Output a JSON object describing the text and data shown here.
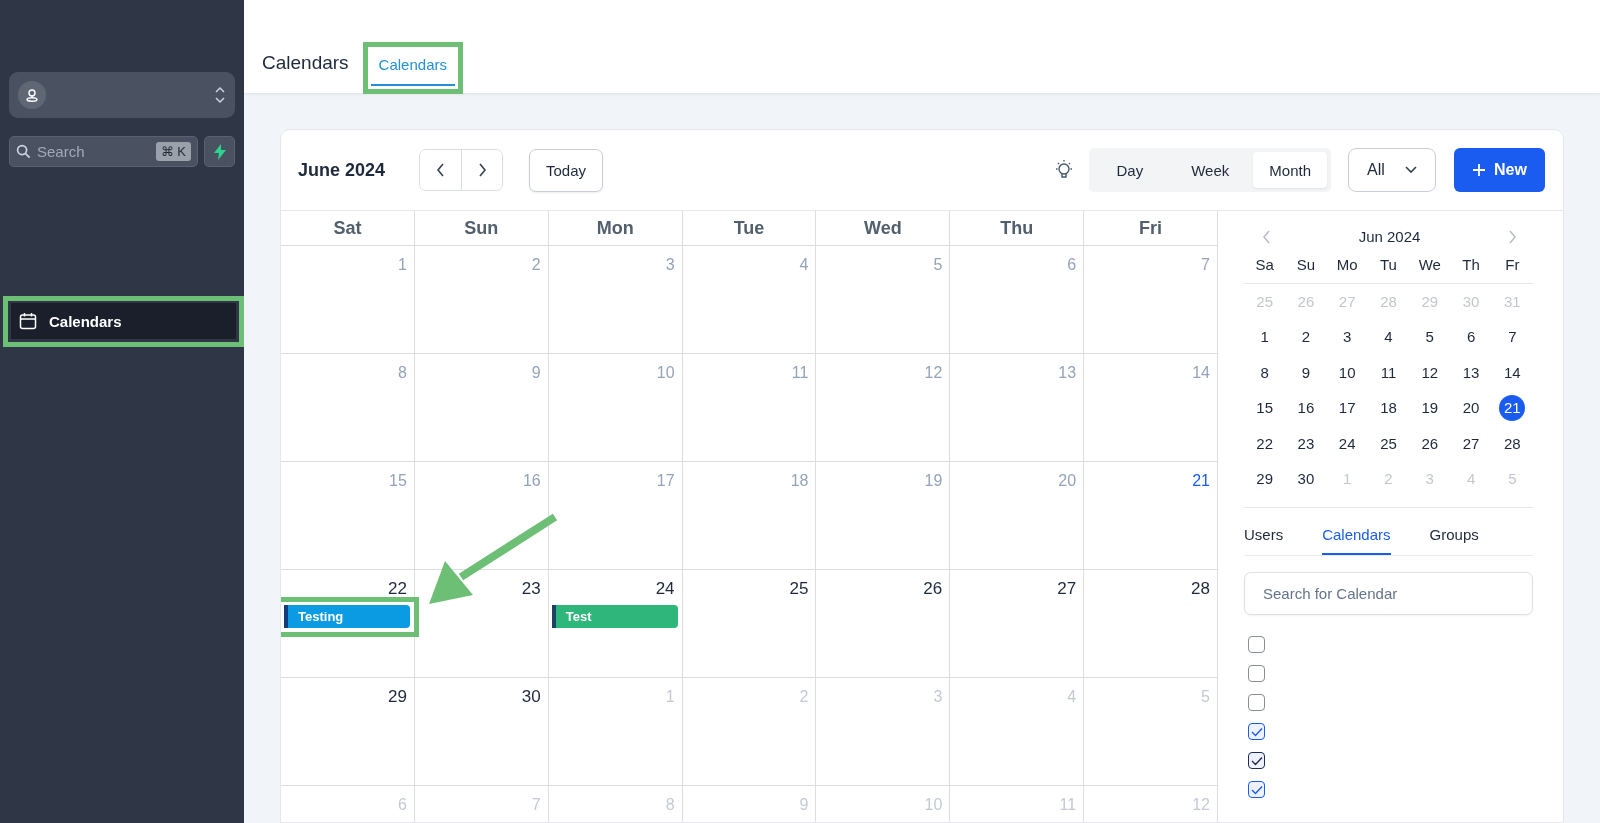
{
  "sidebar": {
    "search": {
      "placeholder": "Search",
      "shortcut": "⌘ K"
    },
    "items": [
      {
        "label": "Calendars",
        "selected": true,
        "highlighted": true
      }
    ]
  },
  "header": {
    "title": "Calendars",
    "tabs": [
      {
        "label": "Calendars",
        "selected": true,
        "highlighted": true
      }
    ]
  },
  "toolbar": {
    "month": "June 2024",
    "today": "Today",
    "views": [
      {
        "label": "Day",
        "selected": false
      },
      {
        "label": "Week",
        "selected": false
      },
      {
        "label": "Month",
        "selected": true
      }
    ],
    "filter": "All",
    "new_button": "New"
  },
  "weekdays": [
    "Sat",
    "Sun",
    "Mon",
    "Tue",
    "Wed",
    "Thu",
    "Fri"
  ],
  "weeks": [
    [
      {
        "day": "1",
        "kind": "past"
      },
      {
        "day": "2",
        "kind": "past"
      },
      {
        "day": "3",
        "kind": "past"
      },
      {
        "day": "4",
        "kind": "past"
      },
      {
        "day": "5",
        "kind": "past"
      },
      {
        "day": "6",
        "kind": "past"
      },
      {
        "day": "7",
        "kind": "past"
      }
    ],
    [
      {
        "day": "8",
        "kind": "past"
      },
      {
        "day": "9",
        "kind": "past"
      },
      {
        "day": "10",
        "kind": "past"
      },
      {
        "day": "11",
        "kind": "past"
      },
      {
        "day": "12",
        "kind": "past"
      },
      {
        "day": "13",
        "kind": "past"
      },
      {
        "day": "14",
        "kind": "past"
      }
    ],
    [
      {
        "day": "15",
        "kind": "past"
      },
      {
        "day": "16",
        "kind": "past"
      },
      {
        "day": "17",
        "kind": "past"
      },
      {
        "day": "18",
        "kind": "past"
      },
      {
        "day": "19",
        "kind": "past"
      },
      {
        "day": "20",
        "kind": "past"
      },
      {
        "day": "21",
        "kind": "today"
      }
    ],
    [
      {
        "day": "22",
        "kind": "future",
        "events": [
          {
            "title": "Testing",
            "color": "#0b9be3",
            "highlighted": true
          }
        ]
      },
      {
        "day": "23",
        "kind": "future"
      },
      {
        "day": "24",
        "kind": "future",
        "events": [
          {
            "title": "Test",
            "color": "#2fb67a",
            "highlighted": false
          }
        ]
      },
      {
        "day": "25",
        "kind": "future"
      },
      {
        "day": "26",
        "kind": "future"
      },
      {
        "day": "27",
        "kind": "future"
      },
      {
        "day": "28",
        "kind": "future"
      }
    ],
    [
      {
        "day": "29",
        "kind": "future"
      },
      {
        "day": "30",
        "kind": "future"
      },
      {
        "day": "1",
        "kind": "other_month"
      },
      {
        "day": "2",
        "kind": "other_month"
      },
      {
        "day": "3",
        "kind": "other_month"
      },
      {
        "day": "4",
        "kind": "other_month"
      },
      {
        "day": "5",
        "kind": "other_month"
      }
    ],
    [
      {
        "day": "6",
        "kind": "other_month"
      },
      {
        "day": "7",
        "kind": "other_month"
      },
      {
        "day": "8",
        "kind": "other_month"
      },
      {
        "day": "9",
        "kind": "other_month"
      },
      {
        "day": "10",
        "kind": "other_month"
      },
      {
        "day": "11",
        "kind": "other_month"
      },
      {
        "day": "12",
        "kind": "other_month"
      }
    ]
  ],
  "annotation_arrow": true,
  "mini_calendar": {
    "title": "Jun 2024",
    "weekdays": [
      "Sa",
      "Su",
      "Mo",
      "Tu",
      "We",
      "Th",
      "Fr"
    ],
    "weeks": [
      [
        {
          "day": "25",
          "muted": true,
          "selected": false
        },
        {
          "day": "26",
          "muted": true,
          "selected": false
        },
        {
          "day": "27",
          "muted": true,
          "selected": false
        },
        {
          "day": "28",
          "muted": true,
          "selected": false
        },
        {
          "day": "29",
          "muted": true,
          "selected": false
        },
        {
          "day": "30",
          "muted": true,
          "selected": false
        },
        {
          "day": "31",
          "muted": true,
          "selected": false
        }
      ],
      [
        {
          "day": "1",
          "muted": false,
          "selected": false
        },
        {
          "day": "2",
          "muted": false,
          "selected": false
        },
        {
          "day": "3",
          "muted": false,
          "selected": false
        },
        {
          "day": "4",
          "muted": false,
          "selected": false
        },
        {
          "day": "5",
          "muted": false,
          "selected": false
        },
        {
          "day": "6",
          "muted": false,
          "selected": false
        },
        {
          "day": "7",
          "muted": false,
          "selected": false
        }
      ],
      [
        {
          "day": "8",
          "muted": false,
          "selected": false
        },
        {
          "day": "9",
          "muted": false,
          "selected": false
        },
        {
          "day": "10",
          "muted": false,
          "selected": false
        },
        {
          "day": "11",
          "muted": false,
          "selected": false
        },
        {
          "day": "12",
          "muted": false,
          "selected": false
        },
        {
          "day": "13",
          "muted": false,
          "selected": false
        },
        {
          "day": "14",
          "muted": false,
          "selected": false
        }
      ],
      [
        {
          "day": "15",
          "muted": false,
          "selected": false
        },
        {
          "day": "16",
          "muted": false,
          "selected": false
        },
        {
          "day": "17",
          "muted": false,
          "selected": false
        },
        {
          "day": "18",
          "muted": false,
          "selected": false
        },
        {
          "day": "19",
          "muted": false,
          "selected": false
        },
        {
          "day": "20",
          "muted": false,
          "selected": false
        },
        {
          "day": "21",
          "muted": false,
          "selected": true
        }
      ],
      [
        {
          "day": "22",
          "muted": false,
          "selected": false
        },
        {
          "day": "23",
          "muted": false,
          "selected": false
        },
        {
          "day": "24",
          "muted": false,
          "selected": false
        },
        {
          "day": "25",
          "muted": false,
          "selected": false
        },
        {
          "day": "26",
          "muted": false,
          "selected": false
        },
        {
          "day": "27",
          "muted": false,
          "selected": false
        },
        {
          "day": "28",
          "muted": false,
          "selected": false
        }
      ],
      [
        {
          "day": "29",
          "muted": false,
          "selected": false
        },
        {
          "day": "30",
          "muted": false,
          "selected": false
        },
        {
          "day": "1",
          "muted": true,
          "selected": false
        },
        {
          "day": "2",
          "muted": true,
          "selected": false
        },
        {
          "day": "3",
          "muted": true,
          "selected": false
        },
        {
          "day": "4",
          "muted": true,
          "selected": false
        },
        {
          "day": "5",
          "muted": true,
          "selected": false
        }
      ]
    ]
  },
  "panel_tabs": [
    {
      "label": "Users",
      "selected": false
    },
    {
      "label": "Calendars",
      "selected": true
    },
    {
      "label": "Groups",
      "selected": false
    }
  ],
  "calendar_search": {
    "placeholder": "Search for Calendar"
  },
  "calendar_list": [
    {
      "checked": false
    },
    {
      "checked": false
    },
    {
      "checked": false
    },
    {
      "checked": true,
      "color": "#1a5cf0"
    },
    {
      "checked": true,
      "color": "#1e2a5a"
    },
    {
      "checked": true,
      "color": "#1a5cf0"
    }
  ]
}
